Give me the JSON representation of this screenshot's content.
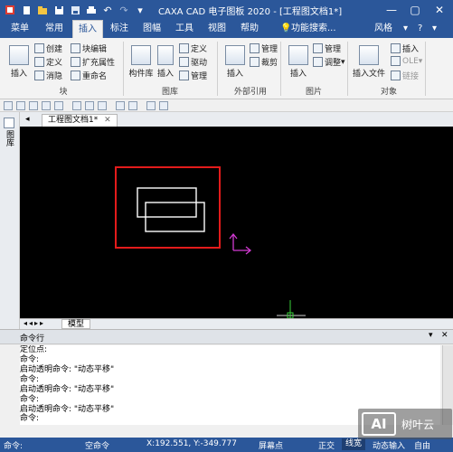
{
  "app": {
    "title": "CAXA CAD 电子图板 2020 - [工程图文档1*]",
    "style_label": "风格",
    "help_icon": "?"
  },
  "menus": [
    "菜单",
    "常用",
    "插入",
    "标注",
    "图幅",
    "工具",
    "视图",
    "帮助"
  ],
  "search": {
    "placeholder": "功能搜索..."
  },
  "ribbon": {
    "block_group": {
      "label": "块",
      "insert": "插入",
      "create": "创建",
      "define": "定义",
      "dissolve": "消隐",
      "block_edit": "块编辑",
      "extend_attr": "扩充属性",
      "rename": "重命名"
    },
    "library_group": {
      "label": "图库",
      "component_lib": "构件库",
      "insert": "插入",
      "define": "定义",
      "drive": "驱动",
      "manage": "管理"
    },
    "external_ref_group": {
      "label": "外部引用",
      "insert": "插入",
      "manage": "管理",
      "clip": "裁剪"
    },
    "image_group": {
      "label": "图片",
      "insert": "插入",
      "manage": "管理",
      "adjust": "调整"
    },
    "object_group": {
      "label": "对象",
      "insert_file": "插入文件",
      "insert": "插入",
      "ole": "OLE",
      "link": "链接"
    }
  },
  "doc_tab": {
    "label": "工程图文档1*"
  },
  "left_panel": {
    "label": "图库"
  },
  "model_tab": {
    "label": "模型"
  },
  "command_panel": {
    "title": "命令行",
    "lines": [
      "定位点:",
      "命令:",
      "启动透明命令: \"动态平移\"",
      "命令:",
      "启动透明命令: \"动态平移\"",
      "命令:",
      "启动透明命令: \"动态平移\""
    ],
    "prompt": "命令:",
    "input_value": ""
  },
  "status": {
    "command": "命令:",
    "empty_command": "空命令",
    "coords": "X:192.551, Y:-349.777",
    "screen_point": "屏幕点",
    "ortho": "正交",
    "lineweight": "线宽",
    "dynamic_input": "动态输入",
    "free": "自由"
  },
  "watermark": {
    "text": "树叶云"
  },
  "colors": {
    "title_bar": "#2b579a",
    "canvas": "#000000",
    "selection_box": "#e31b1b",
    "entity": "#ffffff",
    "ucs": "#d23ad2",
    "cursor": "#3ad23a"
  }
}
